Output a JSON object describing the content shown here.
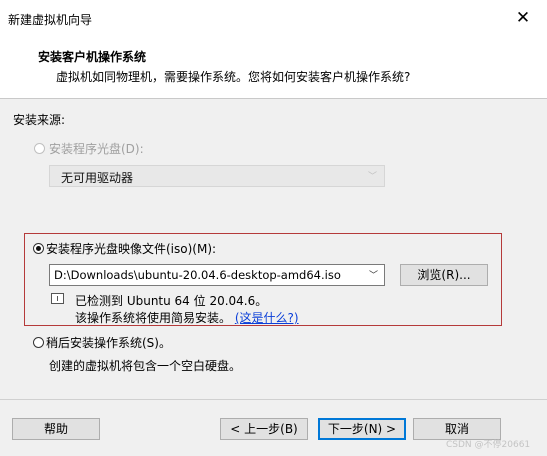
{
  "window": {
    "title": "新建虚拟机向导",
    "close_glyph": "✕"
  },
  "header": {
    "title": "安装客户机操作系统",
    "subtitle": "虚拟机如同物理机，需要操作系统。您将如何安装客户机操作系统?"
  },
  "source": {
    "label": "安装来源:",
    "options": [
      {
        "label": "安装程序光盘(D):",
        "enabled": false,
        "selected": false
      },
      {
        "label": "安装程序光盘映像文件(iso)(M):",
        "enabled": true,
        "selected": true
      },
      {
        "label": "稍后安装操作系统(S)。",
        "enabled": true,
        "selected": false
      }
    ],
    "drive_select": {
      "value": "无可用驱动器",
      "arrow": "﹀"
    },
    "iso_combo": {
      "value": "D:\\Downloads\\ubuntu-20.04.6-desktop-amd64.iso",
      "arrow": "﹀"
    },
    "browse_label": "浏览(R)...",
    "detected_line1": "已检测到 Ubuntu 64 位 20.04.6。",
    "detected_line2": "该操作系统将使用简易安装。",
    "what_link": "(这是什么?)",
    "later_desc": "创建的虚拟机将包含一个空白硬盘。"
  },
  "footer": {
    "help": "帮助",
    "back": "< 上一步(B)",
    "next": "下一步(N) >",
    "cancel": "取消"
  },
  "watermark": "CSDN @不停20661",
  "colors": {
    "highlight_border": "#b53a3a",
    "link": "#0b3fd8",
    "default_button_border": "#0078d7"
  }
}
